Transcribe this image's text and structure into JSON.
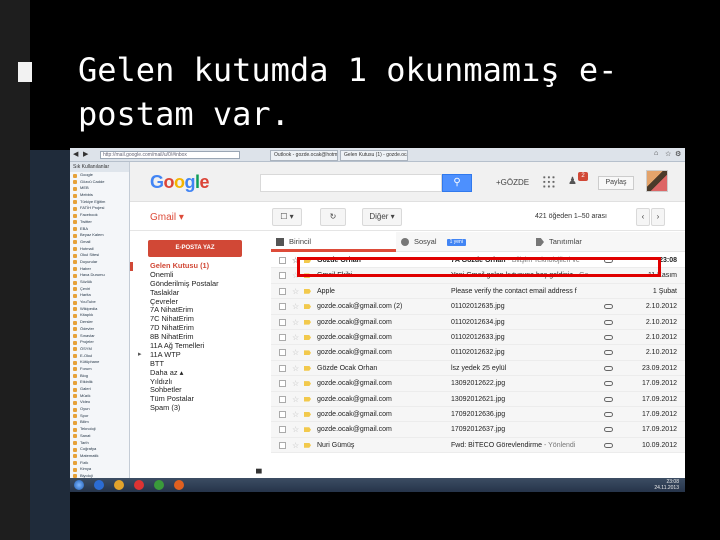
{
  "slide": {
    "title_line1": "Gelen kutumda 1 okunmamış e-",
    "title_line2": "postam var."
  },
  "browser": {
    "url": "http://mail.google.com/mail/u/0/#inbox",
    "tabs": [
      "Outlook - gozde.ocak@hotmail...",
      "Gelen Kutusu (1) - gozde.ocak..."
    ]
  },
  "bookmarks": {
    "header": "Sık Kullanılanlar",
    "items": [
      "Google",
      "Gözcü Cadde",
      "MEB",
      "Mebbis",
      "Türkiye Eğitim",
      "FATİH Projesi",
      "Facebook",
      "Twitter",
      "EBA",
      "Beyaz Kalem",
      "Gmail",
      "Hotmail",
      "Okul Sitesi",
      "Duyurular",
      "Haber",
      "Hava Durumu",
      "Sözlük",
      "Çeviri",
      "Harita",
      "YouTube",
      "Wikipedia",
      "Kitaplık",
      "Dersler",
      "Ödevler",
      "Sınavlar",
      "Projeler",
      "ÖSYM",
      "E-Okul",
      "Kütüphane",
      "Forum",
      "Blog",
      "Etkinlik",
      "Galeri",
      "Müzik",
      "Video",
      "Oyun",
      "Spor",
      "Bilim",
      "Teknoloji",
      "Sanat",
      "Tarih",
      "Coğrafya",
      "Matematik",
      "Fizik",
      "Kimya",
      "Biyoloji",
      "Edebiyat"
    ]
  },
  "gmail": {
    "logo_letters": [
      "G",
      "o",
      "o",
      "g",
      "l",
      "e"
    ],
    "user": "+GÖZDE",
    "notifications": "2",
    "share_label": "Paylaş",
    "gmail_label": "Gmail ▾",
    "more_label": "Diğer ▾",
    "count_text": "421 öğeden 1–50 arası",
    "compose_label": "E-POSTA YAZ",
    "nav": [
      "Gelen Kutusu (1)",
      "Önemli",
      "Gönderilmiş Postalar",
      "Taslaklar",
      "Çevreler",
      "7A NihatErim",
      "7C NihatErim",
      "7D NihatErim",
      "8B NihatErim",
      "11A Ağ Temelleri",
      "11A WTP",
      "BTT",
      "Daha az ▴",
      "Yıldızlı",
      "Sohbetler",
      "Tüm Postalar",
      "Spam (3)"
    ],
    "tabs": [
      {
        "label": "Birincil"
      },
      {
        "label": "Sosyal",
        "badge": "1 yeni"
      },
      {
        "label": "Tanıtımlar"
      }
    ],
    "emails": [
      {
        "sender": "Gözde Orhan",
        "subject": "7A Gözde Orhan",
        "snippet": " - Bilişim Teknolojileri ve",
        "date": "23:08",
        "unread": true,
        "attachment": true
      },
      {
        "sender": "Gmail Ekibi",
        "subject": "Yeni Gmail gelen kutusuna hoş geldiniz",
        "snippet": " - Ge",
        "date": "11 Kasım",
        "unread": false,
        "attachment": false
      },
      {
        "sender": "Apple",
        "subject": "Please verify the contact email address f",
        "snippet": "",
        "date": "1 Şubat",
        "unread": false,
        "attachment": false
      },
      {
        "sender": "gozde.ocak@gmail.com (2)",
        "subject": "01102012635.jpg",
        "snippet": "",
        "date": "2.10.2012",
        "unread": false,
        "attachment": true
      },
      {
        "sender": "gozde.ocak@gmail.com",
        "subject": "01102012634.jpg",
        "snippet": "",
        "date": "2.10.2012",
        "unread": false,
        "attachment": true
      },
      {
        "sender": "gozde.ocak@gmail.com",
        "subject": "01102012633.jpg",
        "snippet": "",
        "date": "2.10.2012",
        "unread": false,
        "attachment": true
      },
      {
        "sender": "gozde.ocak@gmail.com",
        "subject": "01102012632.jpg",
        "snippet": "",
        "date": "2.10.2012",
        "unread": false,
        "attachment": true
      },
      {
        "sender": "Gözde Ocak Orhan",
        "subject": "lsz yedek 25 eylül",
        "snippet": "",
        "date": "23.09.2012",
        "unread": false,
        "attachment": true
      },
      {
        "sender": "gozde.ocak@gmail.com",
        "subject": "13092012622.jpg",
        "snippet": "",
        "date": "17.09.2012",
        "unread": false,
        "attachment": true
      },
      {
        "sender": "gozde.ocak@gmail.com",
        "subject": "13092012621.jpg",
        "snippet": "",
        "date": "17.09.2012",
        "unread": false,
        "attachment": true
      },
      {
        "sender": "gozde.ocak@gmail.com",
        "subject": "17092012636.jpg",
        "snippet": "",
        "date": "17.09.2012",
        "unread": false,
        "attachment": true
      },
      {
        "sender": "gozde.ocak@gmail.com",
        "subject": "17092012637.jpg",
        "snippet": "",
        "date": "17.09.2012",
        "unread": false,
        "attachment": true
      },
      {
        "sender": "Nuri Gümüş",
        "subject": "Fwd: BİTECO Görevlendirme",
        "snippet": " - Yönlendi",
        "date": "10.09.2012",
        "unread": false,
        "attachment": true
      }
    ]
  },
  "taskbar": {
    "time": "23:08",
    "date": "24.11.2013"
  },
  "colors": {
    "highlight": "#e00000",
    "gmail_red": "#d14836",
    "search_blue": "#4d90fe"
  }
}
